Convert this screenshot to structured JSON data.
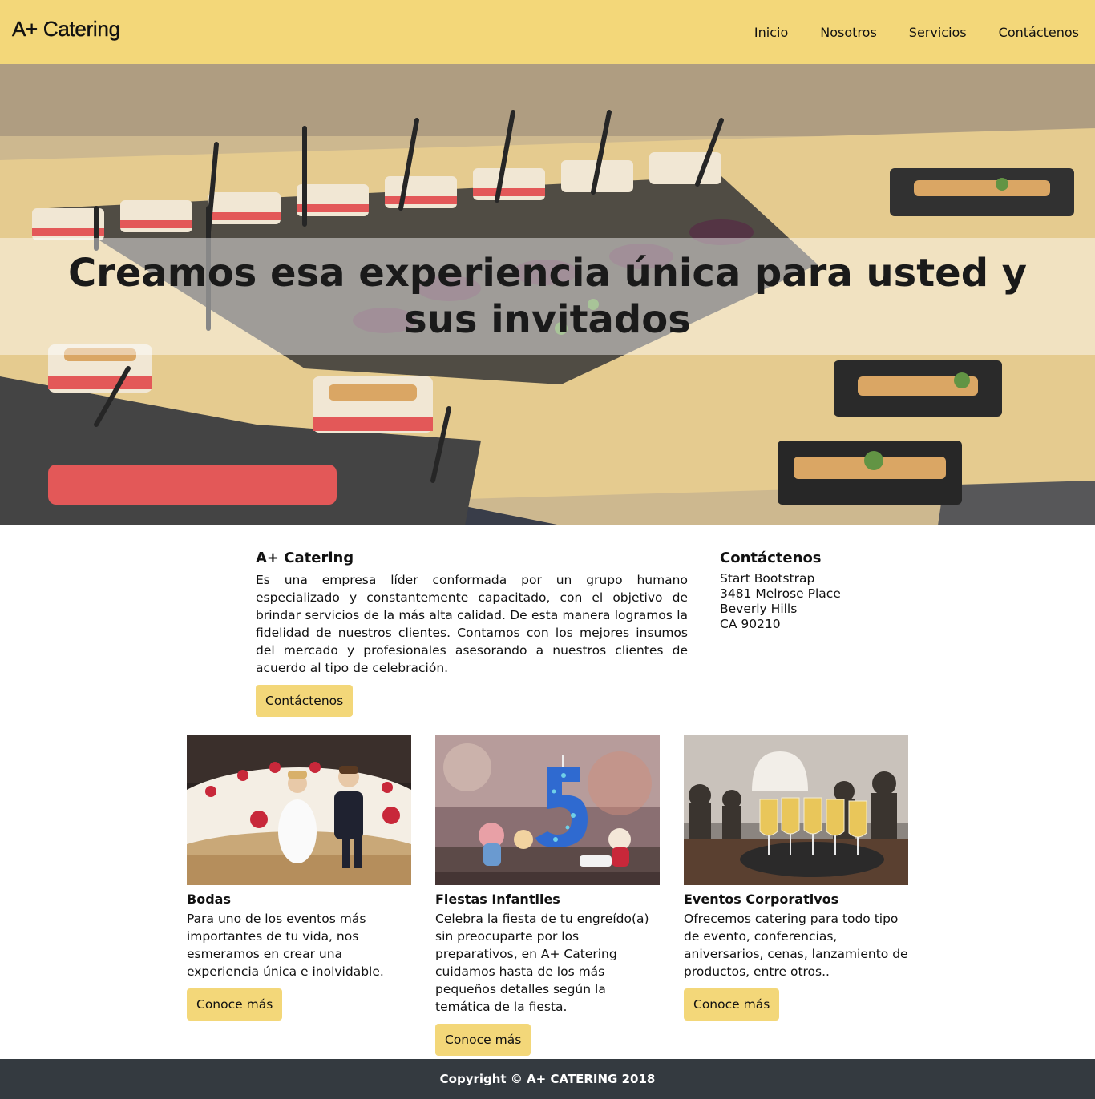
{
  "navbar": {
    "brand": "A+ Catering",
    "links": [
      "Inicio",
      "Nosotros",
      "Servicios",
      "Contáctenos"
    ]
  },
  "hero": {
    "title": "Creamos esa experiencia única para usted y sus invitados"
  },
  "about": {
    "title": "A+ Catering",
    "text": "Es una empresa líder conformada por un grupo humano especializado y constantemente capacitado, con el objetivo de brindar servicios de la más alta calidad. De esta manera logramos la fidelidad de nuestros clientes. Contamos con los mejores insumos del mercado y profesionales asesorando a nuestros clientes de acuerdo al tipo de celebración.",
    "button": "Contáctenos"
  },
  "contact": {
    "title": "Contáctenos",
    "lines": [
      "Start Bootstrap",
      "3481 Melrose Place",
      "Beverly Hills",
      "CA 90210"
    ]
  },
  "cards": [
    {
      "title": "Bodas",
      "text": "Para uno de los eventos más importantes de tu vida, nos esmeramos en crear una experiencia única e inolvidable.",
      "button": "Conoce más"
    },
    {
      "title": "Fiestas Infantiles",
      "text": "Celebra la fiesta de tu engreído(a) sin preocuparte por los preparativos, en A+ Catering cuidamos hasta de los más pequeños detalles según la temática de la fiesta.",
      "button": "Conoce más"
    },
    {
      "title": "Eventos Corporativos",
      "text": "Ofrecemos catering para todo tipo de evento, conferencias, aniversarios, cenas, lanzamiento de productos, entre otros..",
      "button": "Conoce más"
    }
  ],
  "footer": {
    "text": "Copyright © A+ CATERING 2018"
  },
  "colors": {
    "accent": "#f3d779",
    "footer_bg": "#343a40"
  }
}
